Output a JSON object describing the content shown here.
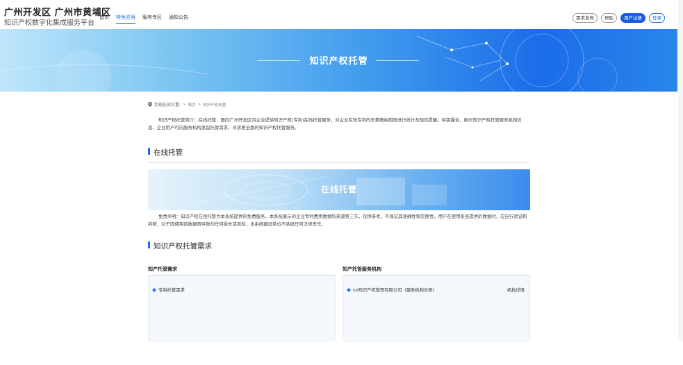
{
  "brand": {
    "title": "广州开发区 广州市黄埔区",
    "subtitle": "知识产权数字化集成服务平台"
  },
  "nav": [
    {
      "label": "首页",
      "active": false
    },
    {
      "label": "特色应用",
      "active": true
    },
    {
      "label": "服务专区",
      "active": false
    },
    {
      "label": "通知公告",
      "active": false
    }
  ],
  "header_buttons": {
    "demand": "需求发布",
    "help": "帮助",
    "register": "用户注册",
    "login": "登录"
  },
  "banner": {
    "title": "知识产权托管"
  },
  "breadcrumb": {
    "location_label": "您现在的位置:",
    "home": "首页",
    "separator": ">",
    "current": "知识产权托管"
  },
  "intro": "知识产权托管简介：在线托管，面向广州开发区内企业提供知识产权(专利)在线托管服务，对企业有效专利的年费缴纳期限进行统计及短信提醒。供需撮合，展示知识产权托管服务机构信息、企业用户可向服务机构发起托管需求，寻求更全面的知识产权托管服务。",
  "section_online": {
    "title": "在线托管",
    "banner_text": "在线托管"
  },
  "disclaimer": "免责声明：知识产权在线托管为本系统提供的免费服务，本系统展示的企业专利费用数据均来源第三方，仅供参考，不保证其准确性和完整性，用户在使用系统提供的数据时，应自行验证和判断，对于因使用该数据而导致的任何损失或风险，本系统建设单位不承担任何法律责任。",
  "section_demand": {
    "title": "知识产权托管需求"
  },
  "demand_column": {
    "title": "知产托管需求",
    "items": [
      "专利托管需求"
    ]
  },
  "agency_column": {
    "title": "知产托管服务机构",
    "items": [
      {
        "name": "xx知识产权管理有限公司（服务机构示例）",
        "link": "机构详情"
      }
    ]
  },
  "colors": {
    "accent": "#1b6ce8",
    "panel_bg": "#f4f7fb"
  }
}
